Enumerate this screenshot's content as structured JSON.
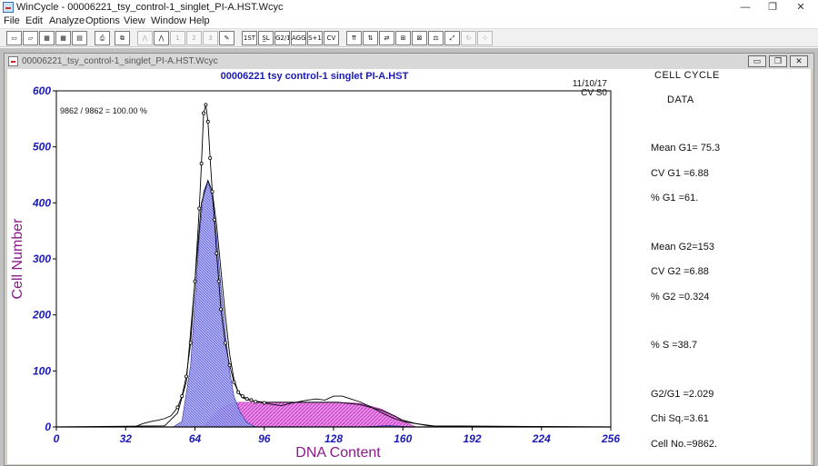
{
  "window": {
    "title": "WinCycle - 00006221_tsy_control-1_singlet_PI-A.HST.Wcyc",
    "controls": {
      "minimize": "—",
      "maximize": "❐",
      "close": "✕"
    }
  },
  "menu": [
    "File",
    "Edit",
    "Analyze",
    "Options",
    "View",
    "Window",
    "Help"
  ],
  "toolbar": {
    "buttons": [
      {
        "name": "new-file-button",
        "glyph": "▭",
        "enabled": true
      },
      {
        "name": "open-file-button",
        "glyph": "▱",
        "enabled": true
      },
      {
        "name": "open-histogram-button",
        "glyph": "▦",
        "enabled": true
      },
      {
        "name": "save-histogram-button",
        "glyph": "▦",
        "enabled": true
      },
      {
        "name": "save-button",
        "glyph": "▤",
        "enabled": true
      },
      {
        "name": "print-button",
        "glyph": "⎙",
        "enabled": true
      },
      {
        "name": "copy-button",
        "glyph": "⧉",
        "enabled": true
      },
      {
        "name": "peak-model-button",
        "glyph": "⋀",
        "enabled": false
      },
      {
        "name": "peak-model-2-button",
        "glyph": "⋀",
        "enabled": true
      },
      {
        "name": "peak-1-button",
        "glyph": "1",
        "enabled": false
      },
      {
        "name": "peak-2-button",
        "glyph": "2",
        "enabled": false
      },
      {
        "name": "peak-3-button",
        "glyph": "3",
        "enabled": false
      },
      {
        "name": "peak-edit-button",
        "glyph": "✎",
        "enabled": true
      },
      {
        "name": "first-button",
        "glyph": "1ST",
        "enabled": true
      },
      {
        "name": "sl-button",
        "glyph": "S̲L",
        "enabled": true
      },
      {
        "name": "g2g1-button",
        "glyph": "G2/1",
        "enabled": true
      },
      {
        "name": "agg-button",
        "glyph": "AGG",
        "enabled": true
      },
      {
        "name": "s-plus-1-button",
        "glyph": "S+1",
        "enabled": true
      },
      {
        "name": "cv-button",
        "glyph": "CV",
        "enabled": true
      },
      {
        "name": "markers-button",
        "glyph": "⇈",
        "enabled": true
      },
      {
        "name": "marker-left-button",
        "glyph": "⇅",
        "enabled": true
      },
      {
        "name": "marker-move-button",
        "glyph": "⇄",
        "enabled": true
      },
      {
        "name": "marker-zoom-button",
        "glyph": "⊞",
        "enabled": true
      },
      {
        "name": "marker-clear-button",
        "glyph": "⊠",
        "enabled": true
      },
      {
        "name": "scale-button",
        "glyph": "⚖",
        "enabled": true
      },
      {
        "name": "rescale-button",
        "glyph": "⤢",
        "enabled": true
      },
      {
        "name": "refresh-button",
        "glyph": "↻",
        "enabled": false
      },
      {
        "name": "fit-button",
        "glyph": "⊹",
        "enabled": false
      }
    ]
  },
  "child_window": {
    "title": "00006221_tsy_control-1_singlet_PI-A.HST.Wcyc",
    "controls": {
      "minimize": "▭",
      "restore": "❐",
      "close": "✕"
    }
  },
  "plot": {
    "title": "00006221 tsy control-1 singlet PI-A.HST",
    "date": "11/10/17",
    "model": "CV S0",
    "gate_text": "9862 / 9862 = 100.00 %"
  },
  "stats": {
    "heading1": "CELL  CYCLE",
    "heading2": "DATA",
    "mean_g1": "Mean G1= 75.3",
    "cv_g1": "CV G1 =6.88",
    "pct_g1": "% G1 =61.",
    "mean_g2": "Mean G2=153",
    "cv_g2": "CV G2 =6.88",
    "pct_g2": "% G2 =0.324",
    "pct_s": "% S  =38.7",
    "g2_g1": "G2/G1 =2.029",
    "chi_sq": "Chi Sq.=3.61",
    "cell_no": "Cell No.=9862."
  },
  "colors": {
    "g1_fill": "#8c8cf0",
    "s_fill": "#e060e0",
    "g2_fill": "#6a3fd0",
    "axis_text": "#1a1ab8",
    "axis_label": "#8b1a8b",
    "histogram": "#000000"
  },
  "chart_data": {
    "type": "area",
    "xlabel": "DNA Content",
    "ylabel": "Cell Number",
    "xlim": [
      0,
      256
    ],
    "ylim": [
      0,
      600
    ],
    "xticks": [
      0,
      32,
      64,
      96,
      128,
      160,
      192,
      224,
      256
    ],
    "yticks": [
      0,
      100,
      200,
      300,
      400,
      500,
      600
    ],
    "histogram": {
      "x": [
        0,
        36,
        40,
        44,
        47,
        50,
        53,
        56,
        58,
        60,
        62,
        64,
        66,
        67,
        68,
        69,
        70,
        71,
        72,
        73,
        74,
        75,
        76,
        78,
        80,
        82,
        84,
        86,
        88,
        90,
        92,
        96,
        100,
        104,
        108,
        112,
        116,
        120,
        124,
        128,
        132,
        136,
        140,
        144,
        148,
        152,
        156,
        160,
        164,
        168,
        172,
        176,
        256
      ],
      "y": [
        0,
        0,
        6,
        10,
        12,
        15,
        20,
        35,
        55,
        90,
        150,
        260,
        390,
        470,
        560,
        575,
        545,
        480,
        420,
        370,
        310,
        260,
        210,
        150,
        110,
        80,
        62,
        55,
        50,
        48,
        45,
        43,
        40,
        38,
        42,
        45,
        48,
        50,
        48,
        55,
        55,
        50,
        45,
        38,
        30,
        22,
        15,
        10,
        7,
        5,
        3,
        1,
        0
      ]
    },
    "model_total": {
      "x": [
        0,
        50,
        56,
        60,
        64,
        67,
        70,
        72,
        74,
        76,
        78,
        80,
        82,
        84,
        86,
        90,
        96,
        110,
        120,
        130,
        140,
        150,
        156,
        160,
        166,
        172,
        256
      ],
      "y": [
        0,
        2,
        25,
        80,
        260,
        400,
        440,
        420,
        360,
        280,
        200,
        130,
        85,
        62,
        52,
        47,
        44,
        44,
        44,
        44,
        40,
        30,
        20,
        12,
        6,
        2,
        0
      ]
    },
    "series": [
      {
        "name": "G1",
        "x": [
          54,
          58,
          62,
          66,
          68,
          70,
          72,
          74,
          76,
          78,
          80,
          82,
          85,
          88,
          92
        ],
        "y": [
          0,
          10,
          110,
          340,
          420,
          440,
          410,
          340,
          250,
          170,
          100,
          55,
          25,
          8,
          0
        ]
      },
      {
        "name": "S",
        "x": [
          68,
          72,
          76,
          80,
          84,
          88,
          96,
          110,
          120,
          130,
          140,
          150,
          156,
          160,
          166
        ],
        "y": [
          0,
          18,
          33,
          40,
          44,
          44,
          44,
          44,
          44,
          44,
          42,
          32,
          20,
          10,
          0
        ]
      },
      {
        "name": "G2",
        "x": [
          140,
          146,
          150,
          153,
          156,
          160,
          166
        ],
        "y": [
          0,
          1,
          2,
          2.5,
          2,
          1,
          0
        ]
      }
    ]
  }
}
